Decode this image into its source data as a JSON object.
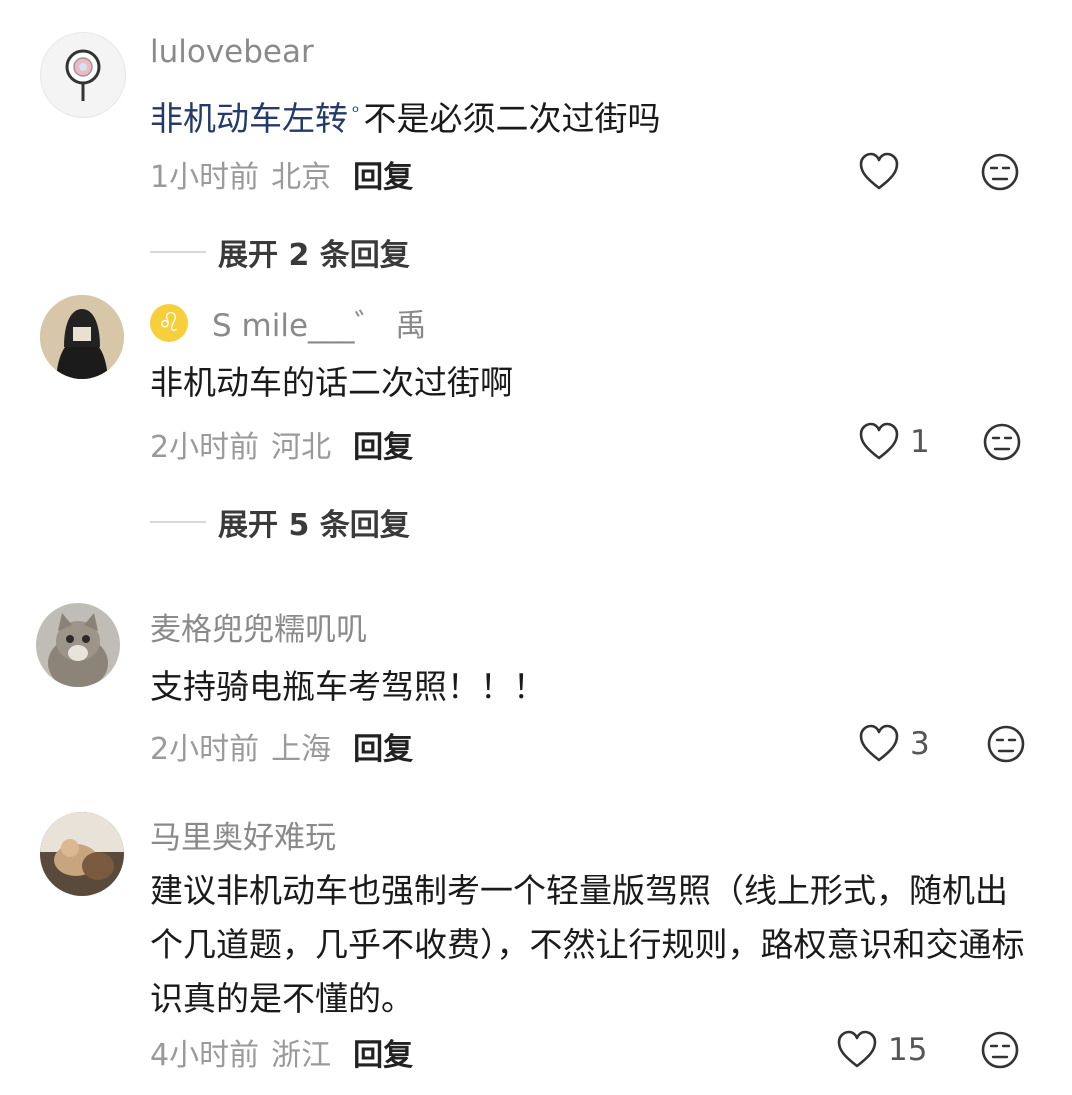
{
  "comments": [
    {
      "username": "lulovebear",
      "keyword": "非机动车左转",
      "content": "不是必须二次过街吗",
      "time": "1小时前",
      "location": "北京",
      "reply": "回复",
      "likes": "",
      "expand": "展开 2 条回复"
    },
    {
      "username_badge": "♌",
      "username": "S mile___゛ 禹",
      "content": "非机动车的话二次过街啊",
      "time": "2小时前",
      "location": "河北",
      "reply": "回复",
      "likes": "1",
      "expand": "展开 5 条回复"
    },
    {
      "username": "麦格兜兜糯叽叽",
      "content": "支持骑电瓶车考驾照！！！",
      "time": "2小时前",
      "location": "上海",
      "reply": "回复",
      "likes": "3"
    },
    {
      "username": "马里奥好难玩",
      "content": "建议非机动车也强制考一个轻量版驾照（线上形式，随机出个几道题，几乎不收费），不然让行规则，路权意识和交通标识真的是不懂的。",
      "time": "4小时前",
      "location": "浙江",
      "reply": "回复",
      "likes": "15"
    }
  ],
  "colors": {
    "background": "#ffffff",
    "username": "#8a8a8a",
    "content": "#1a1a1a",
    "meta": "#9a9a9a",
    "keyword_link": "#233a6b"
  }
}
